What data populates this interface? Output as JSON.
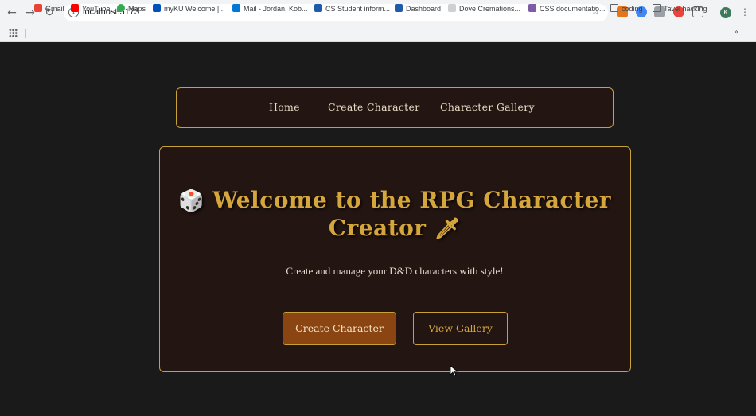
{
  "browser": {
    "url": "localhost:5173",
    "bookmarks": [
      "Gmail",
      "YouTube",
      "Maps",
      "myKU Welcome |...",
      "Mail - Jordan, Kob...",
      "CS Student inform...",
      "Dashboard",
      "Dove Cremations...",
      "CSS documentatio...",
      "coding",
      "Tavel hacking"
    ],
    "profile_initial": "K"
  },
  "nav": {
    "home": "Home",
    "create": "Create Character",
    "gallery": "Character Gallery"
  },
  "hero": {
    "title_line1": "Welcome to the RPG Character",
    "title_line2": "Creator",
    "subtitle": "Create and manage your D&D characters with style!",
    "btn_create": "Create Character",
    "btn_gallery": "View Gallery"
  },
  "colors": {
    "gold": "#c9a13a",
    "panel": "#231512",
    "button": "#8b4513"
  }
}
